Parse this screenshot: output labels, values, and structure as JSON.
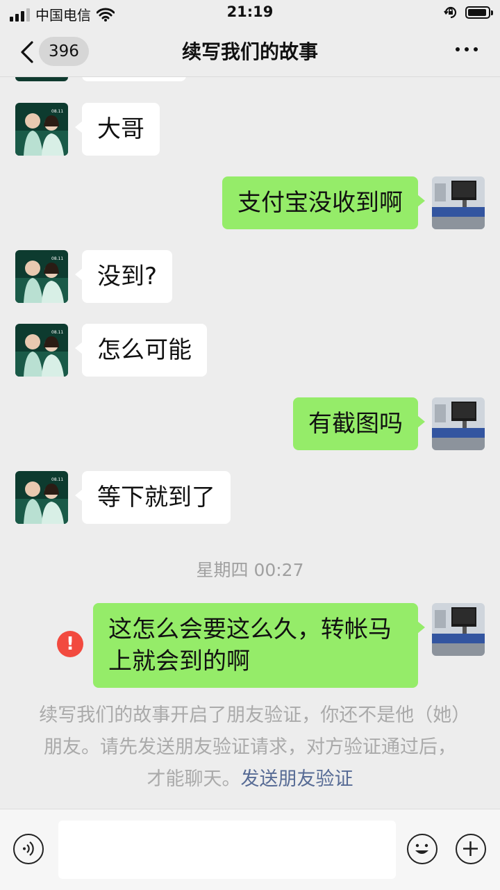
{
  "status_bar": {
    "carrier": "中国电信",
    "time": "21:19"
  },
  "nav": {
    "back_count": "396",
    "title": "续写我们的故事"
  },
  "messages": [
    {
      "side": "in",
      "text": "大哥"
    },
    {
      "side": "out",
      "text": "支付宝没收到啊"
    },
    {
      "side": "in",
      "text": "没到?"
    },
    {
      "side": "in",
      "text": "怎么可能"
    },
    {
      "side": "out",
      "text": "有截图吗"
    },
    {
      "side": "in",
      "text": "等下就到了"
    },
    {
      "side": "out",
      "text_line1": "这怎么会要这么久，转帐马",
      "text_line2": "上就会到的啊",
      "status": "failed"
    }
  ],
  "timestamp": "星期四 00:27",
  "system_notice": {
    "text": "续写我们的故事开启了朋友验证，你还不是他（她）朋友。请先发送朋友验证请求，对方验证通过后，才能聊天。",
    "link": "发送朋友验证"
  },
  "input_bar": {
    "placeholder": ""
  },
  "colors": {
    "background": "#ededed",
    "outgoing_bubble": "#95ec69",
    "incoming_bubble": "#ffffff",
    "link": "#576b95",
    "error": "#f24a3f"
  },
  "icons": [
    "back-arrow-icon",
    "more-icon",
    "voice-icon",
    "emoji-icon",
    "plus-icon",
    "error-icon",
    "wifi-icon",
    "battery-icon",
    "lock-rotation-icon"
  ]
}
